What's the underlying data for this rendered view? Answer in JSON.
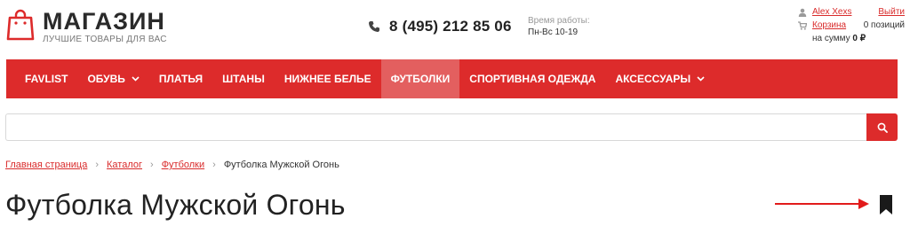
{
  "header": {
    "logo_title": "МАГАЗИН",
    "logo_subtitle": "ЛУЧШИЕ ТОВАРЫ ДЛЯ ВАС",
    "phone": "8 (495) 212 85 06",
    "hours_label": "Время работы:",
    "hours_value": "Пн-Вс 10-19",
    "user_name": "Alex Xexs",
    "logout": "Выйти",
    "cart_label": "Корзина",
    "cart_count": "0 позиций",
    "cart_sum_label": "на сумму",
    "cart_sum": "0 ₽"
  },
  "nav": {
    "items": [
      {
        "label": "FAVLIST"
      },
      {
        "label": "ОБУВЬ"
      },
      {
        "label": "ПЛАТЬЯ"
      },
      {
        "label": "ШТАНЫ"
      },
      {
        "label": "НИЖНЕЕ БЕЛЬЕ"
      },
      {
        "label": "ФУТБОЛКИ"
      },
      {
        "label": "СПОРТИВНАЯ ОДЕЖДА"
      },
      {
        "label": "АКСЕССУАРЫ"
      }
    ]
  },
  "search": {
    "placeholder": "",
    "value": ""
  },
  "breadcrumb": [
    {
      "label": "Главная страница"
    },
    {
      "label": "Каталог"
    },
    {
      "label": "Футболки"
    },
    {
      "label": "Футболка Мужской Огонь"
    }
  ],
  "page": {
    "title": "Футболка Мужской Огонь"
  },
  "colors": {
    "accent": "#dd2b2b",
    "nav_active": "#e35f5f"
  },
  "icons": {
    "logo": "shopping-bag-icon",
    "phone": "phone-icon",
    "user": "user-icon",
    "cart": "cart-icon",
    "search": "search-icon",
    "bookmark": "bookmark-icon",
    "arrow": "arrow-right-icon"
  }
}
